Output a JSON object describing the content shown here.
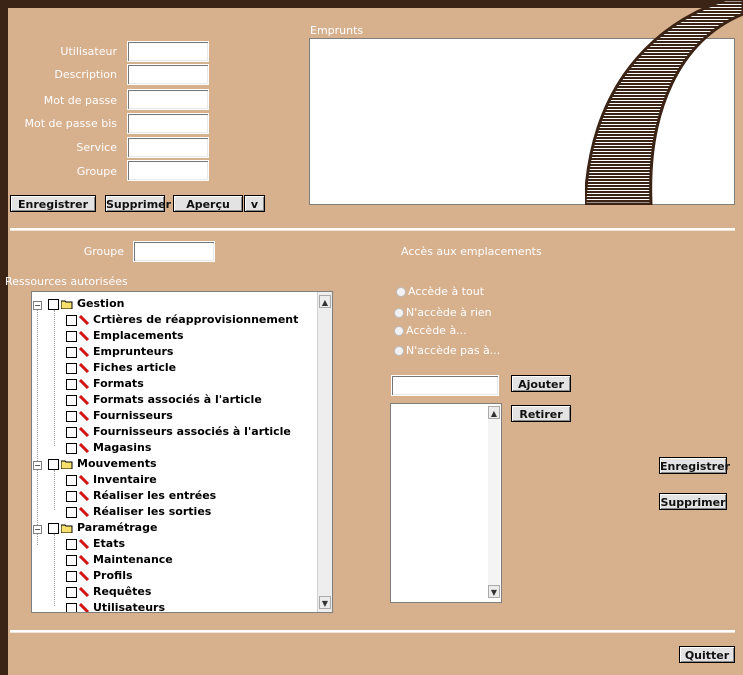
{
  "user_form": {
    "fields": [
      {
        "label": "Utilisateur",
        "value": ""
      },
      {
        "label": "Description",
        "value": ""
      },
      {
        "label": "Mot de passe",
        "value": ""
      },
      {
        "label": "Mot de passe bis",
        "value": ""
      },
      {
        "label": "Service",
        "value": ""
      },
      {
        "label": "Groupe",
        "value": ""
      }
    ],
    "buttons": {
      "save": "Enregistrer",
      "delete": "Supprimer",
      "preview": "Aperçu",
      "dropdown": "v"
    }
  },
  "emprunts": {
    "title": "Emprunts"
  },
  "group_section": {
    "label": "Groupe",
    "value": ""
  },
  "resources": {
    "title": "Ressources autorisées",
    "tree": [
      {
        "label": "Gestion",
        "kind": "folder",
        "level": 0
      },
      {
        "label": "Crtières de réapprovisionnement",
        "kind": "item",
        "level": 1
      },
      {
        "label": "Emplacements",
        "kind": "item",
        "level": 1
      },
      {
        "label": "Emprunteurs",
        "kind": "item",
        "level": 1
      },
      {
        "label": "Fiches article",
        "kind": "item",
        "level": 1
      },
      {
        "label": "Formats",
        "kind": "item",
        "level": 1
      },
      {
        "label": "Formats associés à l'article",
        "kind": "item",
        "level": 1
      },
      {
        "label": "Fournisseurs",
        "kind": "item",
        "level": 1
      },
      {
        "label": "Fournisseurs associés à l'article",
        "kind": "item",
        "level": 1
      },
      {
        "label": "Magasins",
        "kind": "item",
        "level": 1
      },
      {
        "label": "Mouvements",
        "kind": "folder",
        "level": 0
      },
      {
        "label": "Inventaire",
        "kind": "item",
        "level": 1
      },
      {
        "label": "Réaliser les entrées",
        "kind": "item",
        "level": 1
      },
      {
        "label": "Réaliser les sorties",
        "kind": "item",
        "level": 1
      },
      {
        "label": "Paramétrage",
        "kind": "folder",
        "level": 0
      },
      {
        "label": "Etats",
        "kind": "item",
        "level": 1
      },
      {
        "label": "Maintenance",
        "kind": "item",
        "level": 1
      },
      {
        "label": "Profils",
        "kind": "item",
        "level": 1
      },
      {
        "label": "Requêtes",
        "kind": "item",
        "level": 1
      },
      {
        "label": "Utilisateurs",
        "kind": "item",
        "level": 1
      }
    ]
  },
  "access": {
    "title": "Accès aux emplacements",
    "options": [
      "Accède à tout",
      "N'accède à rien",
      "Accède à...",
      "N'accède pas à..."
    ],
    "input_value": "",
    "add_button": "Ajouter",
    "remove_button": "Retirer"
  },
  "right_buttons": {
    "save": "Enregistrer",
    "delete": "Supprimer"
  },
  "quit_button": "Quitter",
  "colors": {
    "background": "#d7b08e",
    "frame": "#3b2416",
    "arc": "#3b2416"
  }
}
